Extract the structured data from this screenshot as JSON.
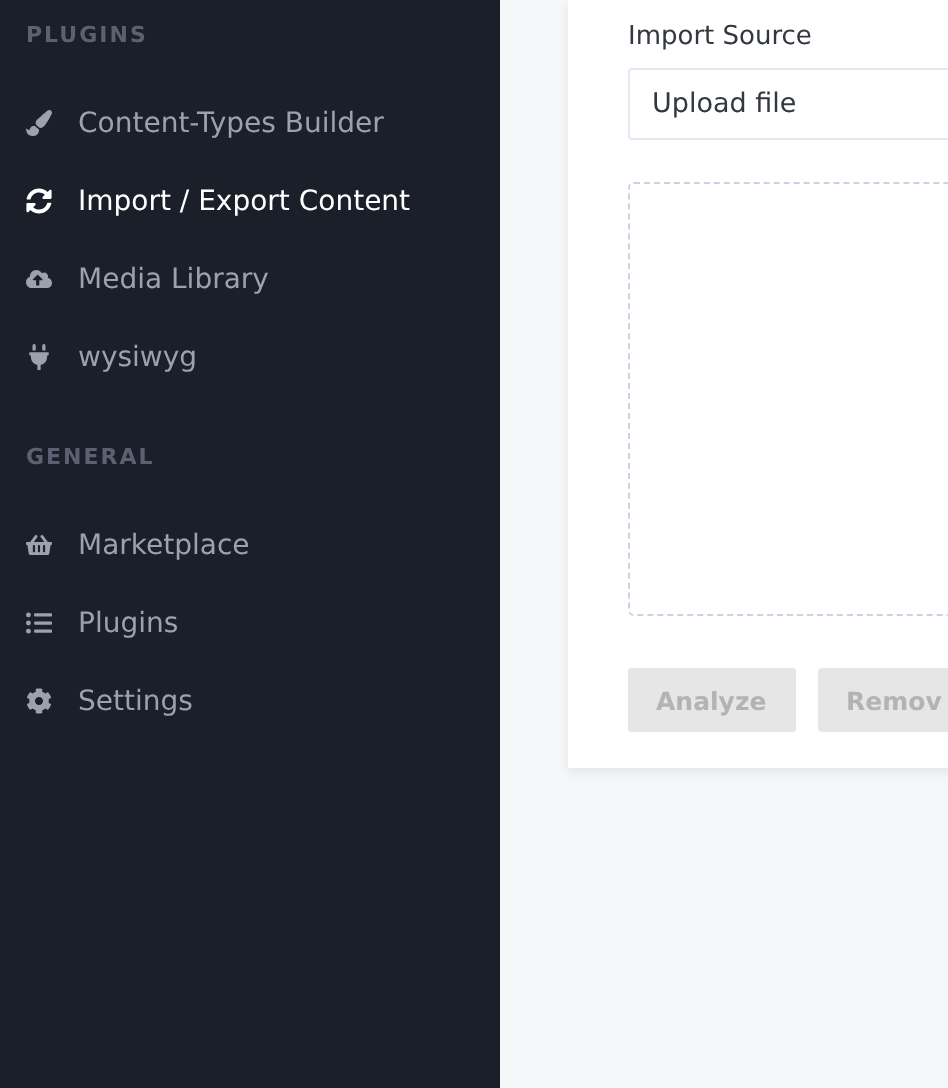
{
  "sidebar": {
    "sections": [
      {
        "title": "PLUGINS",
        "items": [
          {
            "label": "Content-Types Builder",
            "selected": false
          },
          {
            "label": "Import / Export Content",
            "selected": true
          },
          {
            "label": "Media Library",
            "selected": false
          },
          {
            "label": "wysiwyg",
            "selected": false
          }
        ]
      },
      {
        "title": "GENERAL",
        "items": [
          {
            "label": "Marketplace",
            "selected": false
          },
          {
            "label": "Plugins",
            "selected": false
          },
          {
            "label": "Settings",
            "selected": false
          }
        ]
      }
    ]
  },
  "import_form": {
    "label": "Import Source",
    "source": "Upload file",
    "buttons": [
      {
        "label": "Analyze",
        "disabled": true
      },
      {
        "label": "Remov",
        "disabled": true
      }
    ]
  }
}
